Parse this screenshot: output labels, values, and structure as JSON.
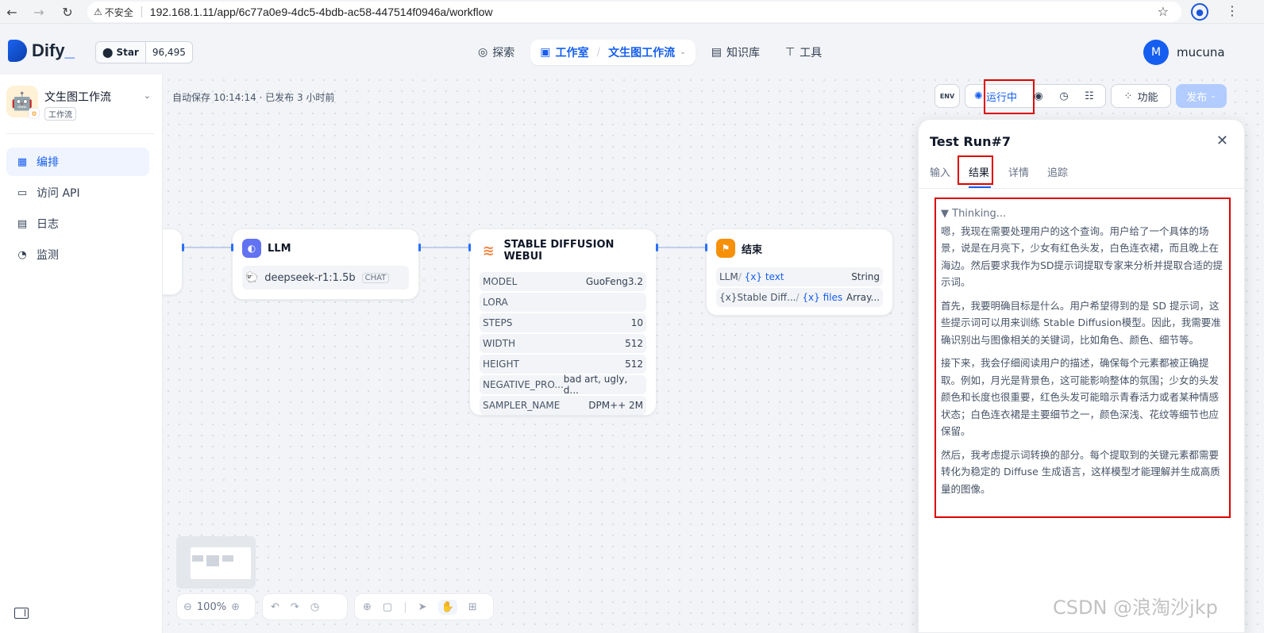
{
  "browser": {
    "insecure_label": "不安全",
    "url": "192.168.1.11/app/6c77a0e9-4dc5-4bdb-ac58-447514f0946a/workflow"
  },
  "header": {
    "logo": "Dify",
    "github_label": "Star",
    "github_count": "96,495",
    "nav": {
      "explore": "探索",
      "studio": "工作室",
      "current_app": "文生图工作流",
      "knowledge": "知识库",
      "tools": "工具"
    },
    "user_initial": "M",
    "user_name": "mucuna"
  },
  "sidebar": {
    "app_name": "文生图工作流",
    "app_type": "工作流",
    "items": [
      {
        "label": "编排",
        "icon": "layout-icon"
      },
      {
        "label": "访问 API",
        "icon": "terminal-icon"
      },
      {
        "label": "日志",
        "icon": "log-icon"
      },
      {
        "label": "监测",
        "icon": "monitor-icon"
      }
    ]
  },
  "canvas": {
    "autosave": "自动保存 10:14:14 · 已发布 3 小时前",
    "toolbar": {
      "env": "ENV",
      "running": "运行中",
      "features": "功能",
      "publish": "发布"
    },
    "nodes": {
      "llm": {
        "title": "LLM",
        "model": "deepseek-r1:1.5b",
        "mode": "CHAT"
      },
      "sd": {
        "title": "STABLE DIFFUSION WEBUI",
        "params": [
          {
            "key": "MODEL",
            "value": "GuoFeng3.2"
          },
          {
            "key": "LORA",
            "value": ""
          },
          {
            "key": "STEPS",
            "value": "10"
          },
          {
            "key": "WIDTH",
            "value": "512"
          },
          {
            "key": "HEIGHT",
            "value": "512"
          },
          {
            "key": "NEGATIVE_PRO...",
            "value": "bad art, ugly, d..."
          },
          {
            "key": "SAMPLER_NAME",
            "value": "DPM++ 2M"
          }
        ]
      },
      "end": {
        "title": "结束",
        "outputs": [
          {
            "source": "LLM",
            "var": "text",
            "type": "String"
          },
          {
            "source": "Stable Diff...",
            "var": "files",
            "type": "Array..."
          }
        ]
      }
    },
    "zoom": "100%"
  },
  "run_panel": {
    "title": "Test Run#7",
    "tabs": [
      "输入",
      "结果",
      "详情",
      "追踪"
    ],
    "thinking": "▼ Thinking...",
    "paragraphs": [
      "嗯，我现在需要处理用户的这个查询。用户给了一个具体的场景，说是在月亮下，少女有红色头发，白色连衣裙，而且晚上在海边。然后要求我作为SD提示词提取专家来分析并提取合适的提示词。",
      "首先，我要明确目标是什么。用户希望得到的是 SD 提示词，这些提示词可以用来训练 Stable Diffusion模型。因此，我需要准确识别出与图像相关的关键词，比如角色、颜色、细节等。",
      "接下来，我会仔细阅读用户的描述，确保每个元素都被正确提取。例如，月光是背景色，这可能影响整体的氛围；少女的头发颜色和长度也很重要，红色头发可能暗示青春活力或者某种情感状态；白色连衣裙是主要细节之一，颜色深浅、花纹等细节也应保留。",
      "然后，我考虑提示词转换的部分。每个提取到的关键元素都需要转化为稳定的 Diffuse 生成语言，这样模型才能理解并生成高质量的图像。"
    ]
  },
  "watermark": "CSDN @浪淘沙jkp"
}
